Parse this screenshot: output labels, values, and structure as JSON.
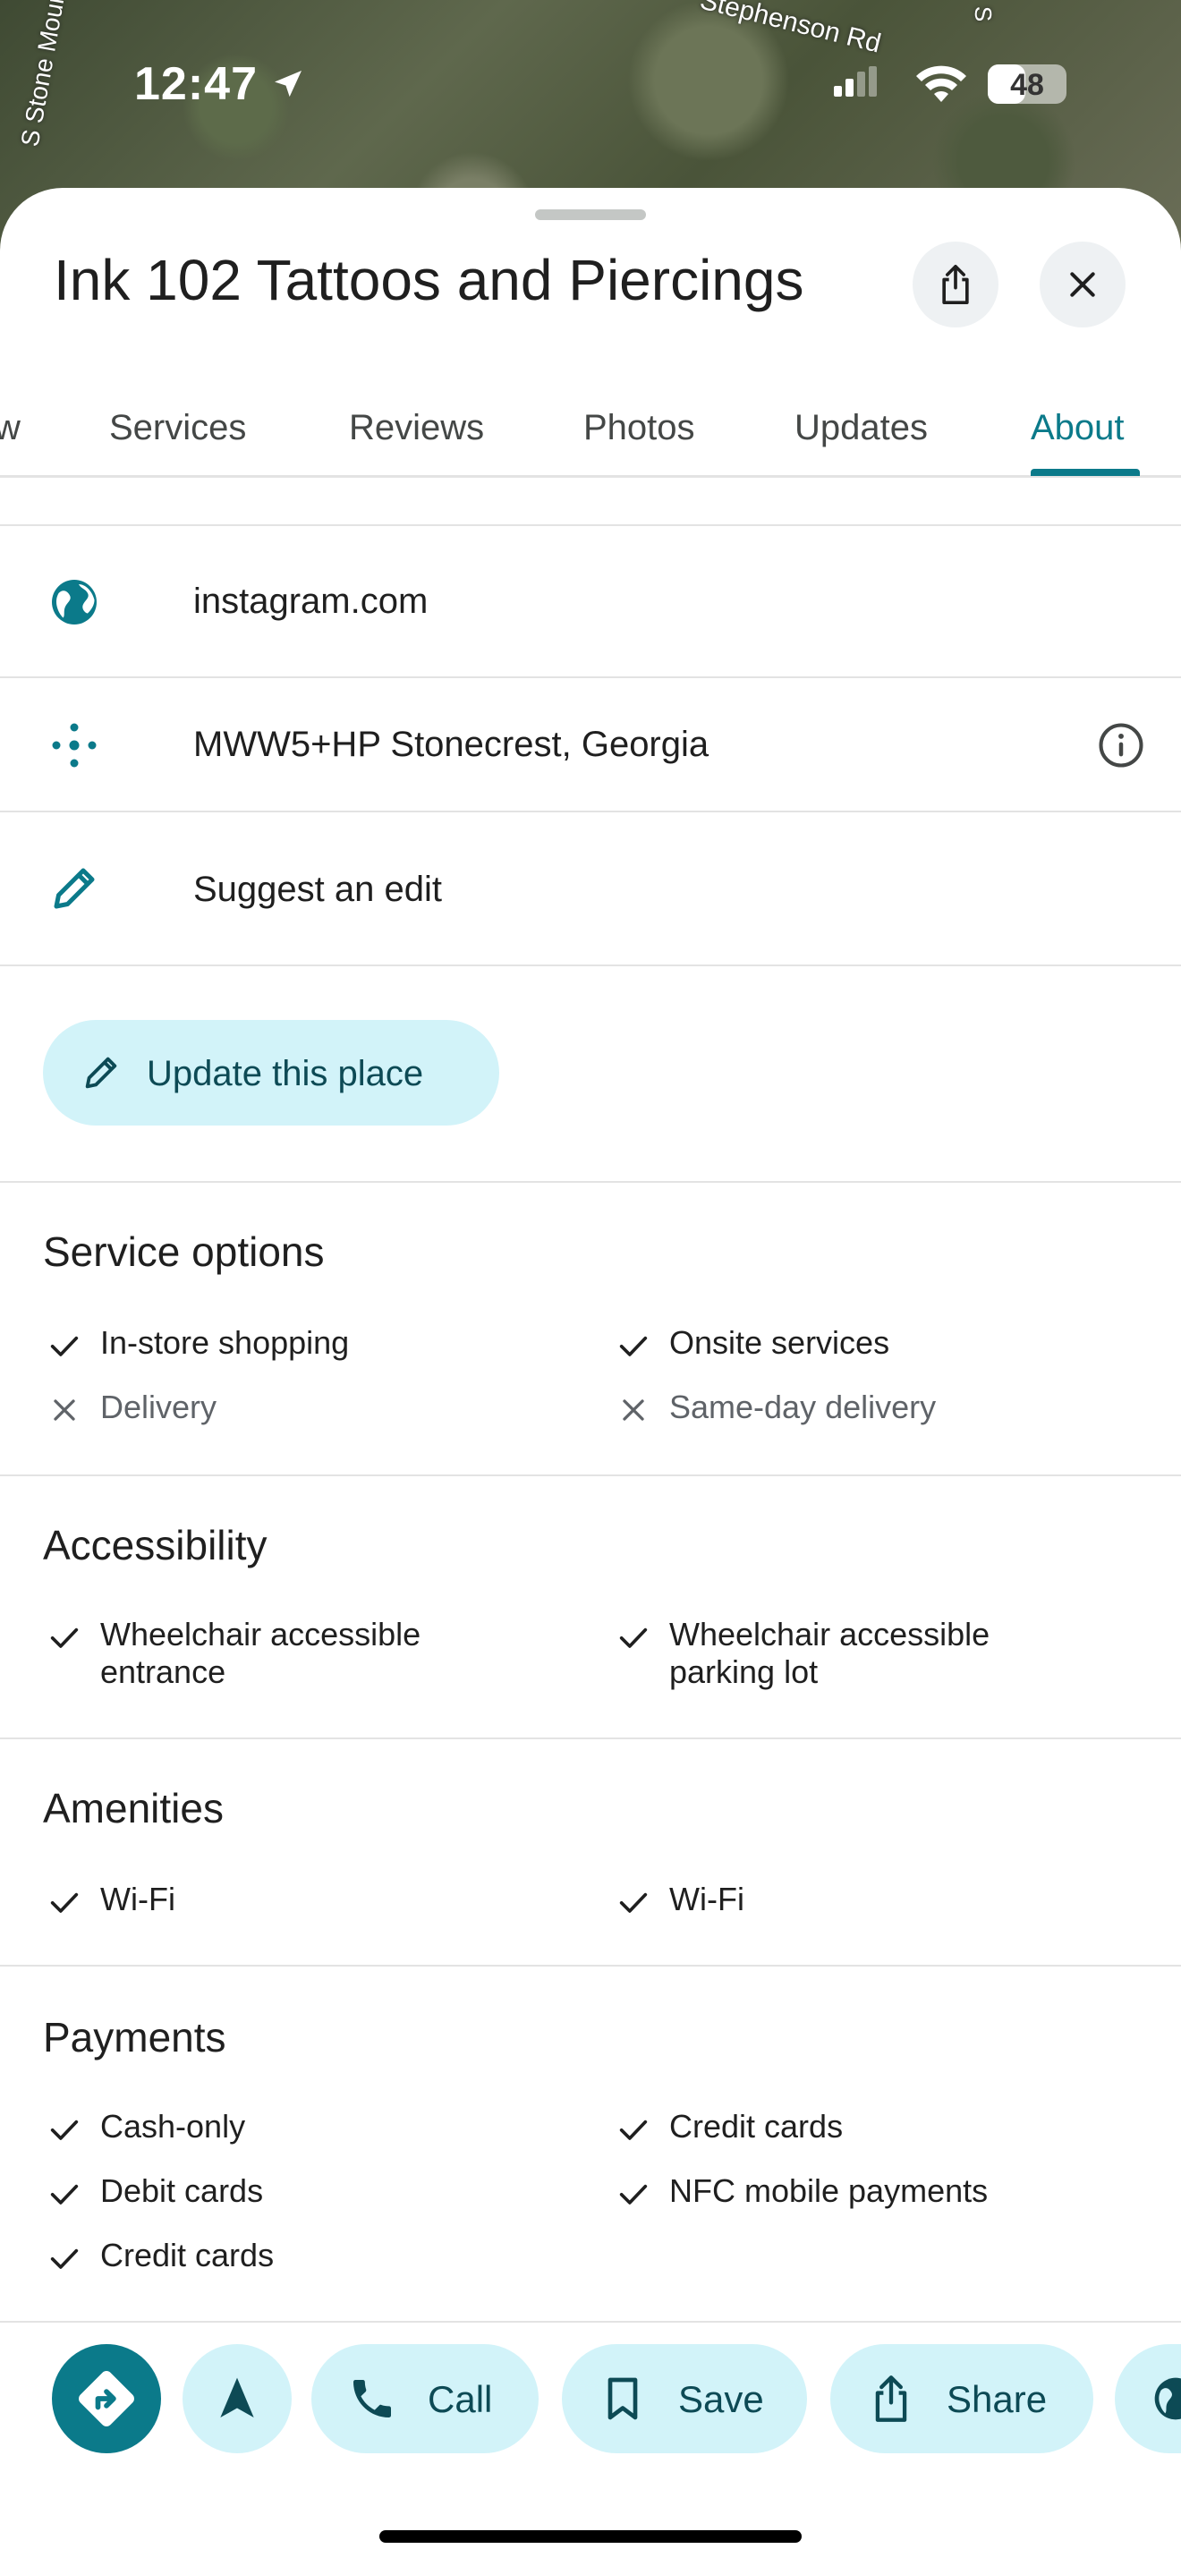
{
  "map": {
    "roads": [
      "Stephenson Rd",
      "S Stone Moun",
      "S"
    ]
  },
  "status_bar": {
    "time": "12:47",
    "battery": "48",
    "battery_level": 0.48
  },
  "place": {
    "title": "Ink 102 Tattoos and Piercings"
  },
  "tabs": [
    {
      "label": "w"
    },
    {
      "label": "Services"
    },
    {
      "label": "Reviews"
    },
    {
      "label": "Photos"
    },
    {
      "label": "Updates"
    },
    {
      "label": "About"
    }
  ],
  "active_tab": "About",
  "info_rows": {
    "website": "instagram.com",
    "plus_code": "MWW5+HP Stonecrest, Georgia",
    "suggest_edit": "Suggest an edit"
  },
  "update_button": {
    "label": "Update this place"
  },
  "sections": {
    "service_options": {
      "title": "Service options",
      "items": [
        {
          "label": "In-store shopping",
          "available": true
        },
        {
          "label": "Onsite services",
          "available": true
        },
        {
          "label": "Delivery",
          "available": false
        },
        {
          "label": "Same-day delivery",
          "available": false
        }
      ]
    },
    "accessibility": {
      "title": "Accessibility",
      "items": [
        {
          "label": "Wheelchair accessible entrance",
          "available": true
        },
        {
          "label": "Wheelchair accessible parking lot",
          "available": true
        }
      ]
    },
    "amenities": {
      "title": "Amenities",
      "items": [
        {
          "label": "Wi-Fi",
          "available": true
        },
        {
          "label": "Wi-Fi",
          "available": true
        }
      ]
    },
    "payments": {
      "title": "Payments",
      "items": [
        {
          "label": "Cash-only",
          "available": true
        },
        {
          "label": "Credit cards",
          "available": true
        },
        {
          "label": "Debit cards",
          "available": true
        },
        {
          "label": "NFC mobile payments",
          "available": true
        },
        {
          "label": "Credit cards",
          "available": true
        }
      ]
    }
  },
  "actions": {
    "call": "Call",
    "save": "Save",
    "share": "Share"
  },
  "colors": {
    "accent": "#0b7a8a",
    "chip_bg": "#d2f3f9",
    "chip_text": "#0d4a55"
  }
}
